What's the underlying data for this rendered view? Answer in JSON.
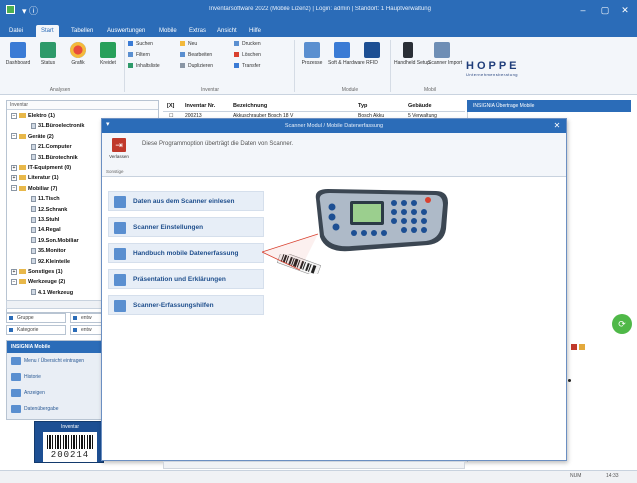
{
  "window": {
    "title": "Inventarsoftware 2022 (Mobile Lizenz) | Login: admin | Standort: 1 Hauptverwaltung",
    "min": "–",
    "max": "▢",
    "close": "✕"
  },
  "menu": {
    "tabs": [
      "Datei",
      "Start",
      "Tabellen",
      "Auswertungen",
      "Mobile",
      "Extras",
      "Ansicht",
      "Hilfe"
    ],
    "active_index": 1
  },
  "ribbon": {
    "analyse_buttons": [
      "Dashboard",
      "Status",
      "Grafik",
      "Kreidet"
    ],
    "analyse_group": "Analysen",
    "inventar_small": [
      [
        "Suchen",
        "Neu",
        "Drucken"
      ],
      [
        "Filtern",
        "Bearbeiten",
        "Löschen"
      ],
      [
        "Inhaltsliste",
        "Duplizieren",
        "Transfer"
      ]
    ],
    "inventar_group": "Inventar",
    "module_buttons": [
      "Prozesse",
      "Soft & Hardware",
      "RFID"
    ],
    "module_group": "Module",
    "mobile_buttons": [
      "Handheld Setup",
      "Scanner Import"
    ],
    "mobile_group": "Mobil",
    "brand": "HOPPE",
    "brand_sub": "Unternehmensberatung"
  },
  "tree": {
    "header": "Inventar",
    "nodes": [
      {
        "label": "Elektro (1)",
        "level": 0,
        "toggle": "−",
        "type": "folder"
      },
      {
        "label": "31.Büroelectronik",
        "level": 1,
        "toggle": "",
        "type": "doc"
      },
      {
        "label": "Geräte (2)",
        "level": 0,
        "toggle": "−",
        "type": "folder"
      },
      {
        "label": "21.Computer",
        "level": 1,
        "toggle": "",
        "type": "doc"
      },
      {
        "label": "31.Bürotechnik",
        "level": 1,
        "toggle": "",
        "type": "doc"
      },
      {
        "label": "IT-Equipment (0)",
        "level": 0,
        "toggle": "+",
        "type": "folder"
      },
      {
        "label": "Literatur (1)",
        "level": 0,
        "toggle": "+",
        "type": "folder"
      },
      {
        "label": "Mobiliar (7)",
        "level": 0,
        "toggle": "−",
        "type": "folder"
      },
      {
        "label": "11.Tisch",
        "level": 1,
        "toggle": "",
        "type": "doc"
      },
      {
        "label": "12.Schrank",
        "level": 1,
        "toggle": "",
        "type": "doc"
      },
      {
        "label": "13.Stuhl",
        "level": 1,
        "toggle": "",
        "type": "doc"
      },
      {
        "label": "14.Regal",
        "level": 1,
        "toggle": "",
        "type": "doc"
      },
      {
        "label": "19.Son.Mobiliar",
        "level": 1,
        "toggle": "",
        "type": "doc"
      },
      {
        "label": "35.Monitor",
        "level": 1,
        "toggle": "",
        "type": "doc"
      },
      {
        "label": "92.Kleinteile",
        "level": 1,
        "toggle": "",
        "type": "doc"
      },
      {
        "label": "Sonstiges (1)",
        "level": 0,
        "toggle": "+",
        "type": "folder"
      },
      {
        "label": "Werkzeuge (2)",
        "level": 0,
        "toggle": "−",
        "type": "folder"
      },
      {
        "label": "4.1 Werkzeug",
        "level": 1,
        "toggle": "",
        "type": "doc"
      }
    ]
  },
  "filters": [
    {
      "left": "Gruppe",
      "right": "entw"
    },
    {
      "left": "Kategorie",
      "right": "entw"
    }
  ],
  "leftnav": {
    "header": "INSIGNIA Mobile",
    "items": [
      "Menu / Übersicht eintragen",
      "Historie",
      "Anzeigen",
      "Datenübergabe"
    ]
  },
  "label": {
    "title": "Inventar",
    "number": "200214"
  },
  "table": {
    "headers": [
      "[X]",
      "Inventar Nr.",
      "Bezeichnung",
      "Typ",
      "Gebäude"
    ],
    "row": [
      "☐",
      "200213",
      "Akkuschrauber Bosch 18 V",
      "Bosch Akku",
      "5 Verwaltung"
    ]
  },
  "rightpanel": {
    "header": "INSIGNIA      Übertrage Mobile"
  },
  "dialog": {
    "title": "Scanner Modul / Mobile Datenerfassung",
    "close": "✕",
    "exit_label": "Verlassen",
    "info": "Diese Programmoption überträgt die Daten von Scanner.",
    "group_label": "Sonstige",
    "buttons": [
      "Daten aus dem Scanner einlesen",
      "Scanner Einstellungen",
      "Handbuch mobile Datenerfassung",
      "Präsentation und Erklärungen",
      "Scanner-Erfassungshilfen"
    ],
    "scanner_icon": "handheld-scanner-illustration"
  },
  "status": {
    "left": "",
    "mode": "NUM",
    "time": "14:33"
  },
  "colors": {
    "brand_blue": "#2b6cb8",
    "button_bg": "#e7eef7",
    "button_text": "#1f4f8d",
    "exit_red": "#c0392b",
    "green": "#4fb848"
  }
}
